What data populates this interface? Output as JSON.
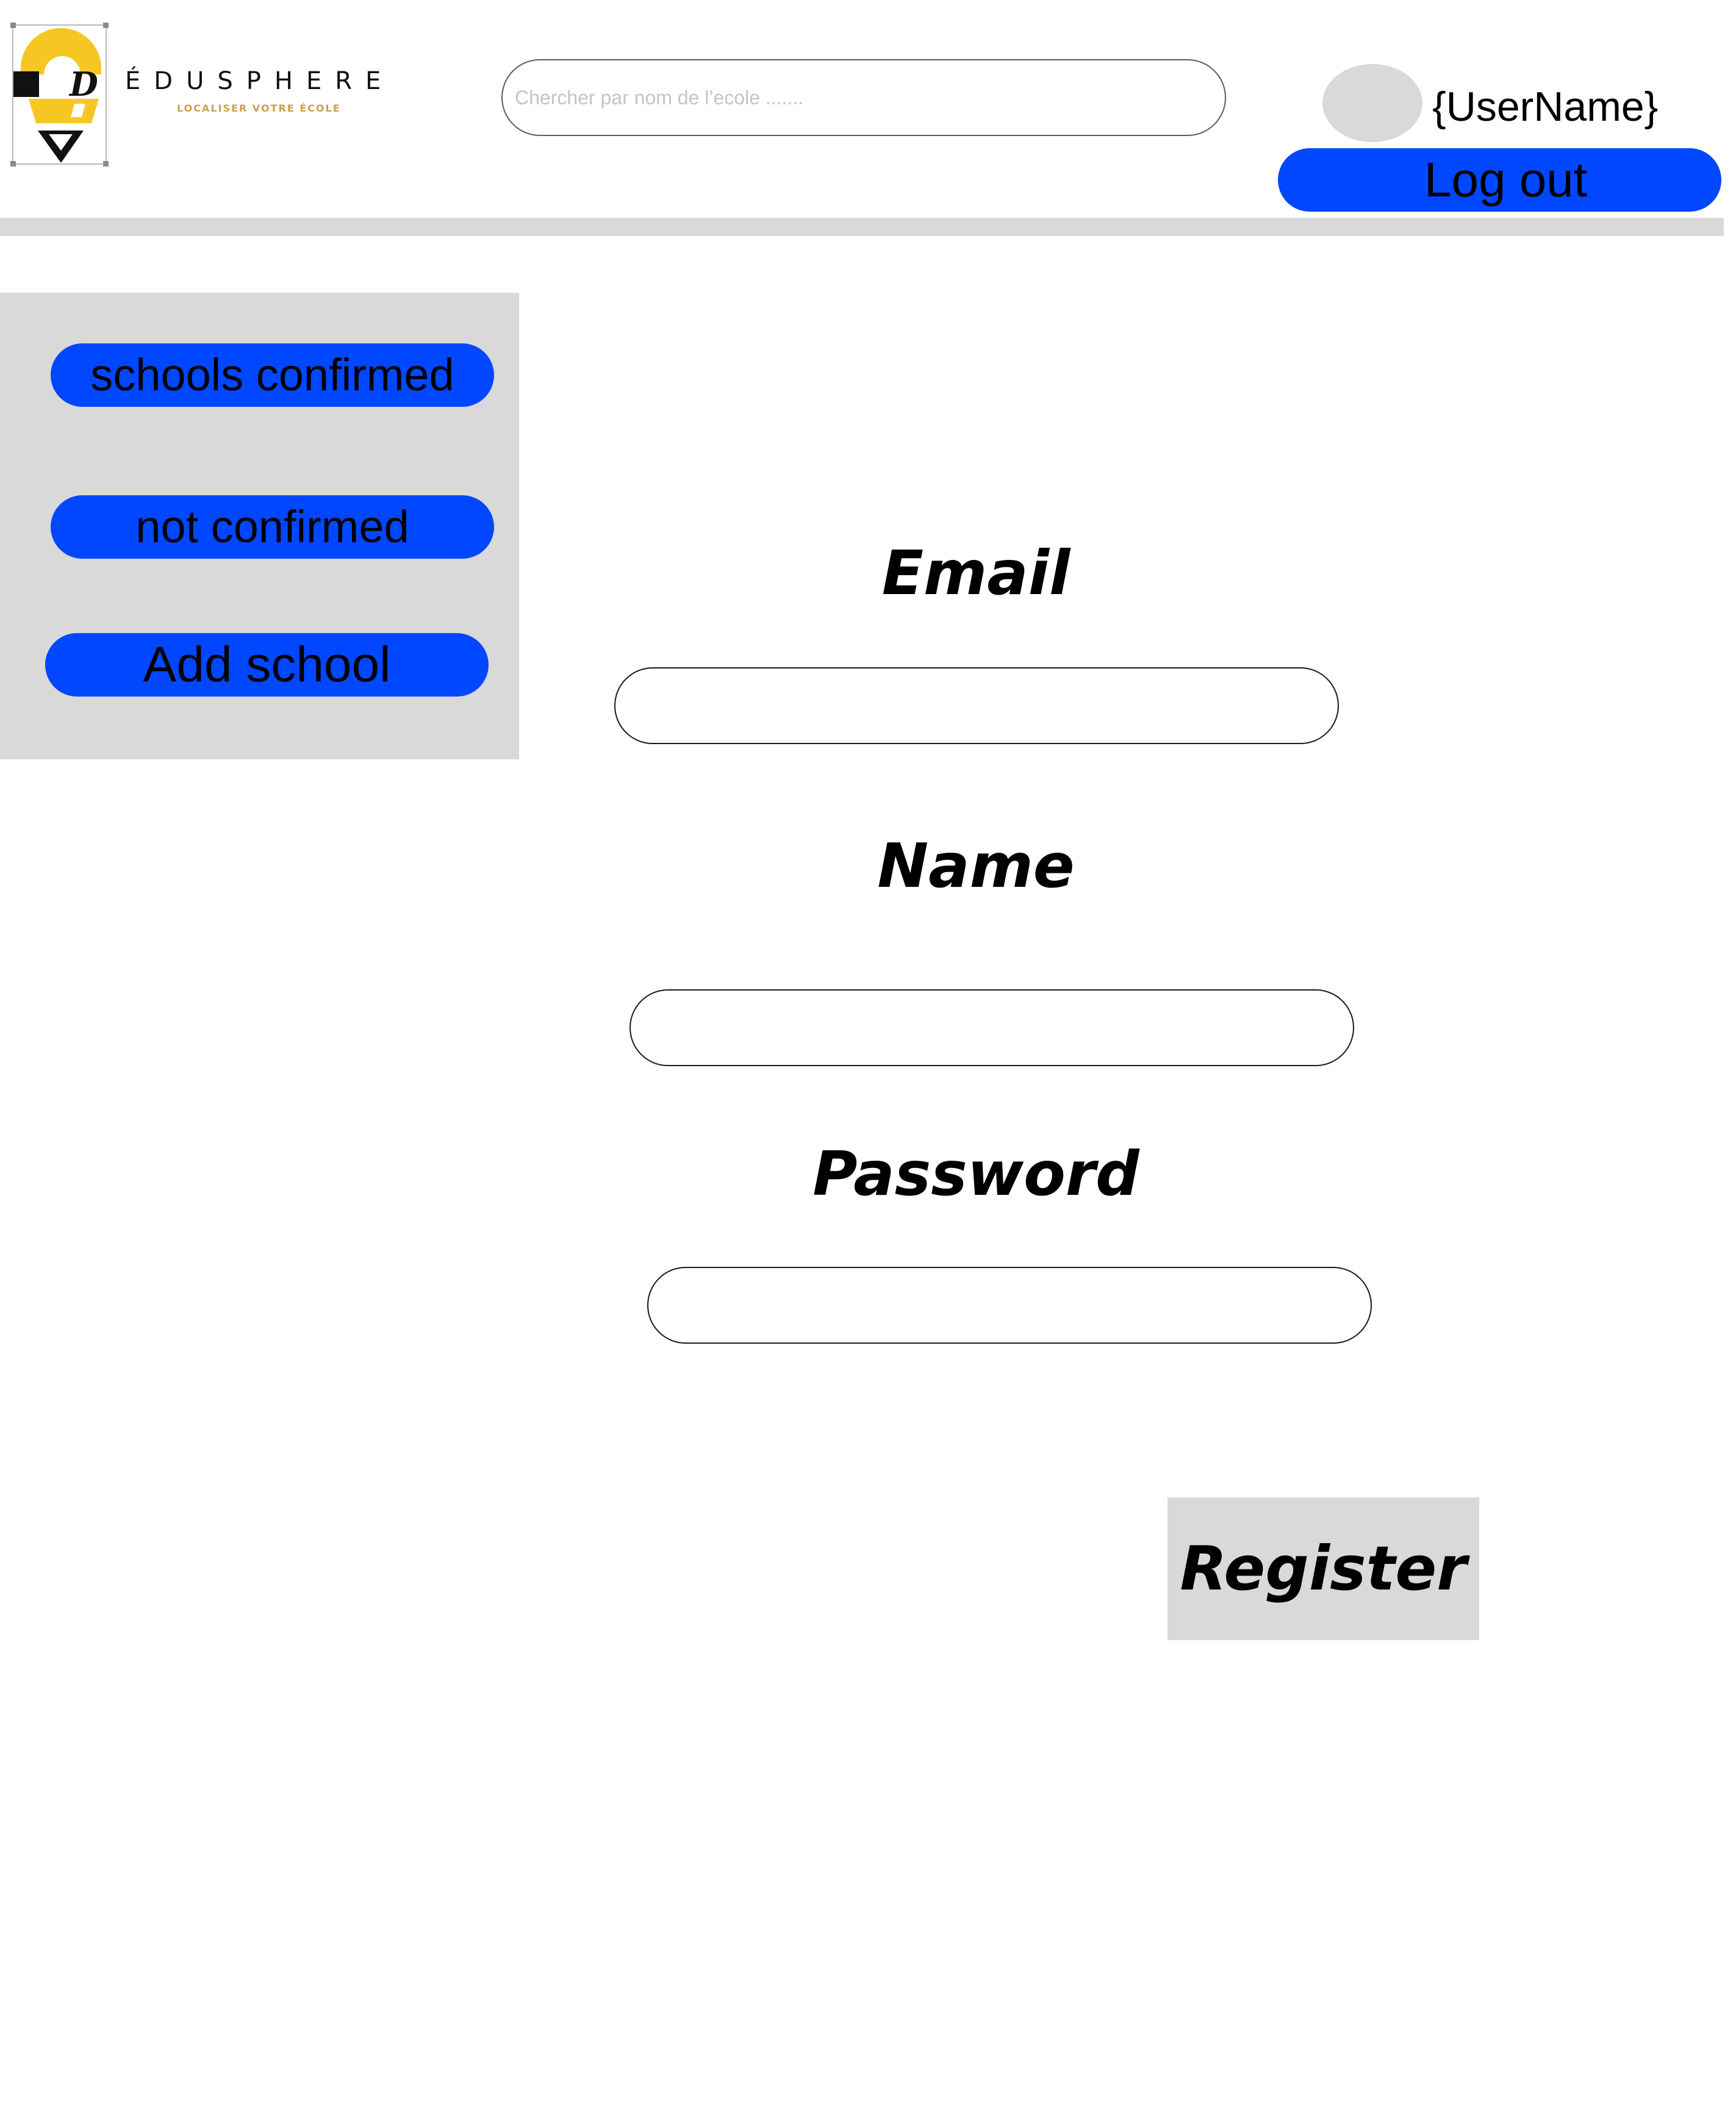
{
  "header": {
    "brand": {
      "name": "ÉDUSPHERE",
      "tagline": "LOCALISER VOTRE ÉCOLE",
      "logo_letter": "D"
    },
    "search": {
      "placeholder": "Chercher par nom de l’ecole .......",
      "value": ""
    },
    "user": {
      "username": "{UserName}"
    },
    "logout_label": "Log out"
  },
  "sidebar": {
    "items": [
      {
        "label": "schools confirmed"
      },
      {
        "label": "not confirmed"
      },
      {
        "label": "Add school"
      }
    ]
  },
  "form": {
    "email_label": "Email",
    "email_value": "",
    "name_label": "Name",
    "name_value": "",
    "password_label": "Password",
    "password_value": "",
    "submit_label": "Register"
  },
  "colors": {
    "primary_button": "#0047ff",
    "panel_gray": "#d9d9d9",
    "logo_yellow": "#f6c623",
    "tagline_gold": "#c9a24a"
  },
  "icons": {
    "logo": "edusphere-pin-logo",
    "avatar": "user-avatar-placeholder"
  }
}
